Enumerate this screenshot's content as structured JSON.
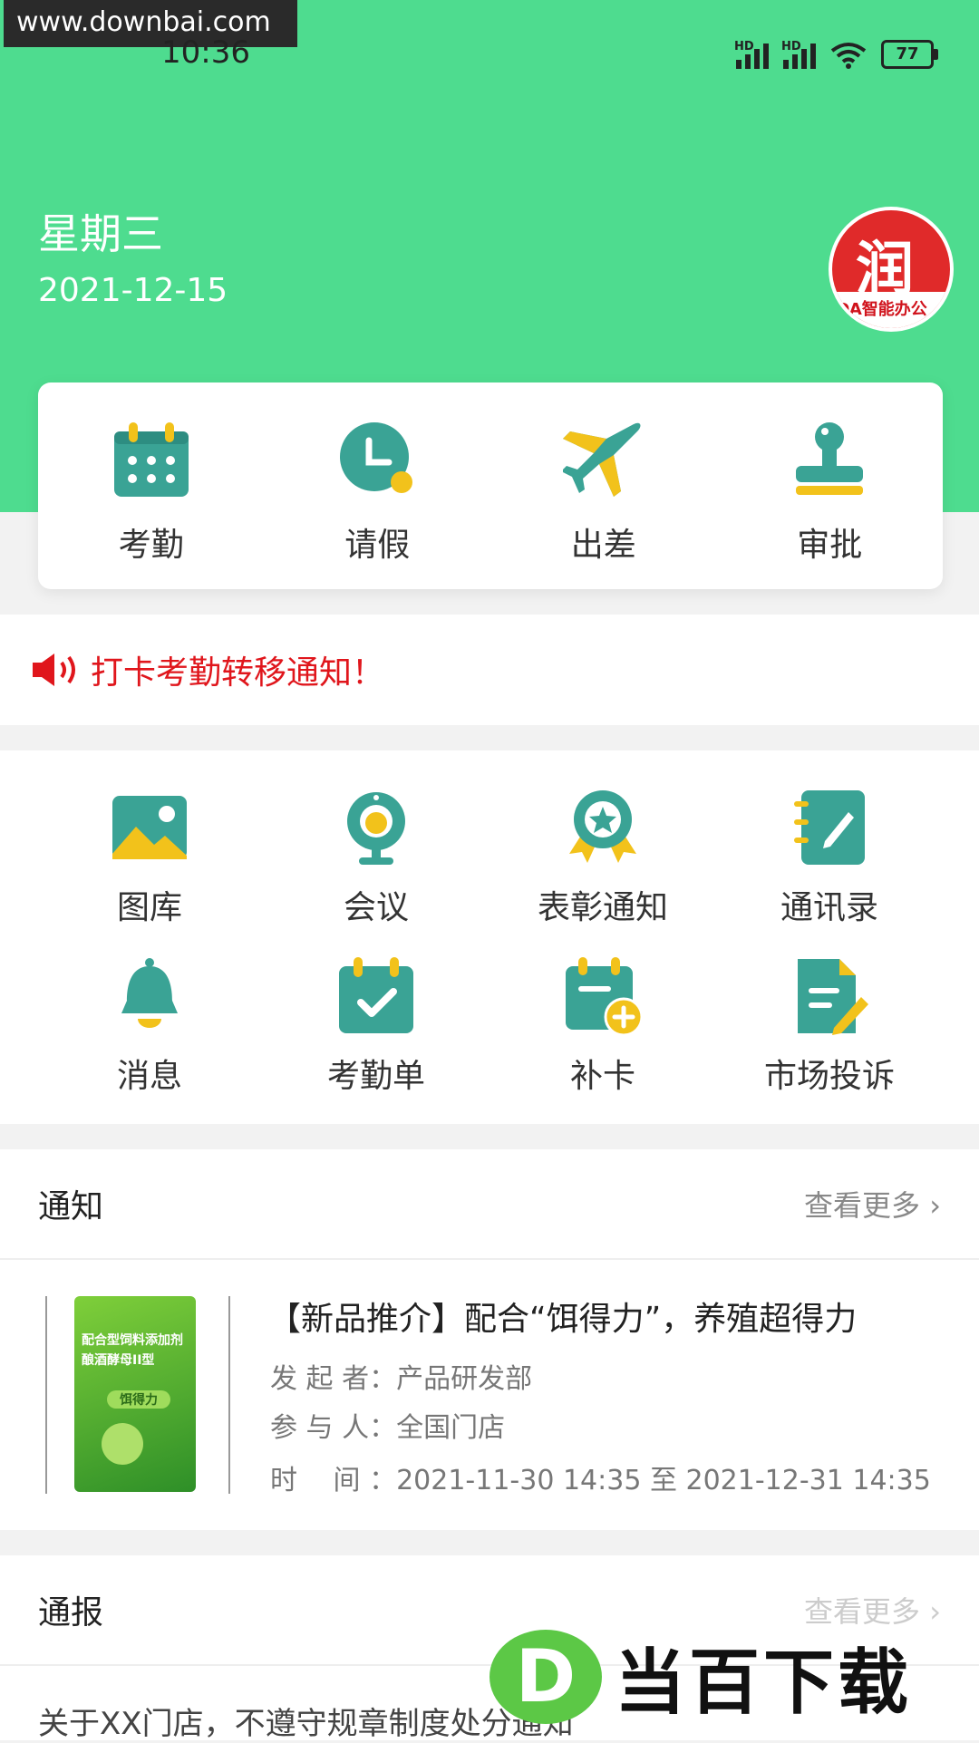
{
  "watermark_top": "www.downbai.com",
  "status_bar": {
    "time": "10:36",
    "battery": "77"
  },
  "header": {
    "weekday": "星期三",
    "date": "2021-12-15",
    "logo_text": "OA智能办公"
  },
  "quick_actions": [
    {
      "label": "考勤",
      "icon": "calendar-icon"
    },
    {
      "label": "请假",
      "icon": "clock-icon"
    },
    {
      "label": "出差",
      "icon": "airplane-icon"
    },
    {
      "label": "审批",
      "icon": "stamp-icon"
    }
  ],
  "announcement": "打卡考勤转移通知！",
  "apps": [
    {
      "label": "图库",
      "icon": "gallery-icon"
    },
    {
      "label": "会议",
      "icon": "webcam-icon"
    },
    {
      "label": "表彰通知",
      "icon": "award-icon"
    },
    {
      "label": "通讯录",
      "icon": "notebook-icon"
    },
    {
      "label": "消息",
      "icon": "bell-icon"
    },
    {
      "label": "考勤单",
      "icon": "calendar-check-icon"
    },
    {
      "label": "补卡",
      "icon": "calendar-add-icon"
    },
    {
      "label": "市场投诉",
      "icon": "document-edit-icon"
    }
  ],
  "notice_section": {
    "title": "通知",
    "more": "查看更多",
    "item": {
      "title": "【新品推介】配合“饵得力”，养殖超得力",
      "initiator": "发 起 者：产品研发部",
      "participants": "参 与 人：全国门店",
      "time": "时　 间 ：2021-11-30 14:35 至 2021-12-31 14:35",
      "thumb_lines": [
        "配合型饲料添加剂",
        "酿酒酵母II型",
        "饵得力"
      ]
    }
  },
  "report_section": {
    "title": "通报",
    "more": "查看更多",
    "item_text": "关于XX门店，不遵守规章制度处分通知"
  },
  "watermark_bottom": {
    "letter": "D",
    "text": "当百下载"
  },
  "colors": {
    "header_green": "#4edc8f",
    "teal": "#3aa395",
    "yellow": "#f2c21b",
    "alert_red": "#e0161c"
  }
}
